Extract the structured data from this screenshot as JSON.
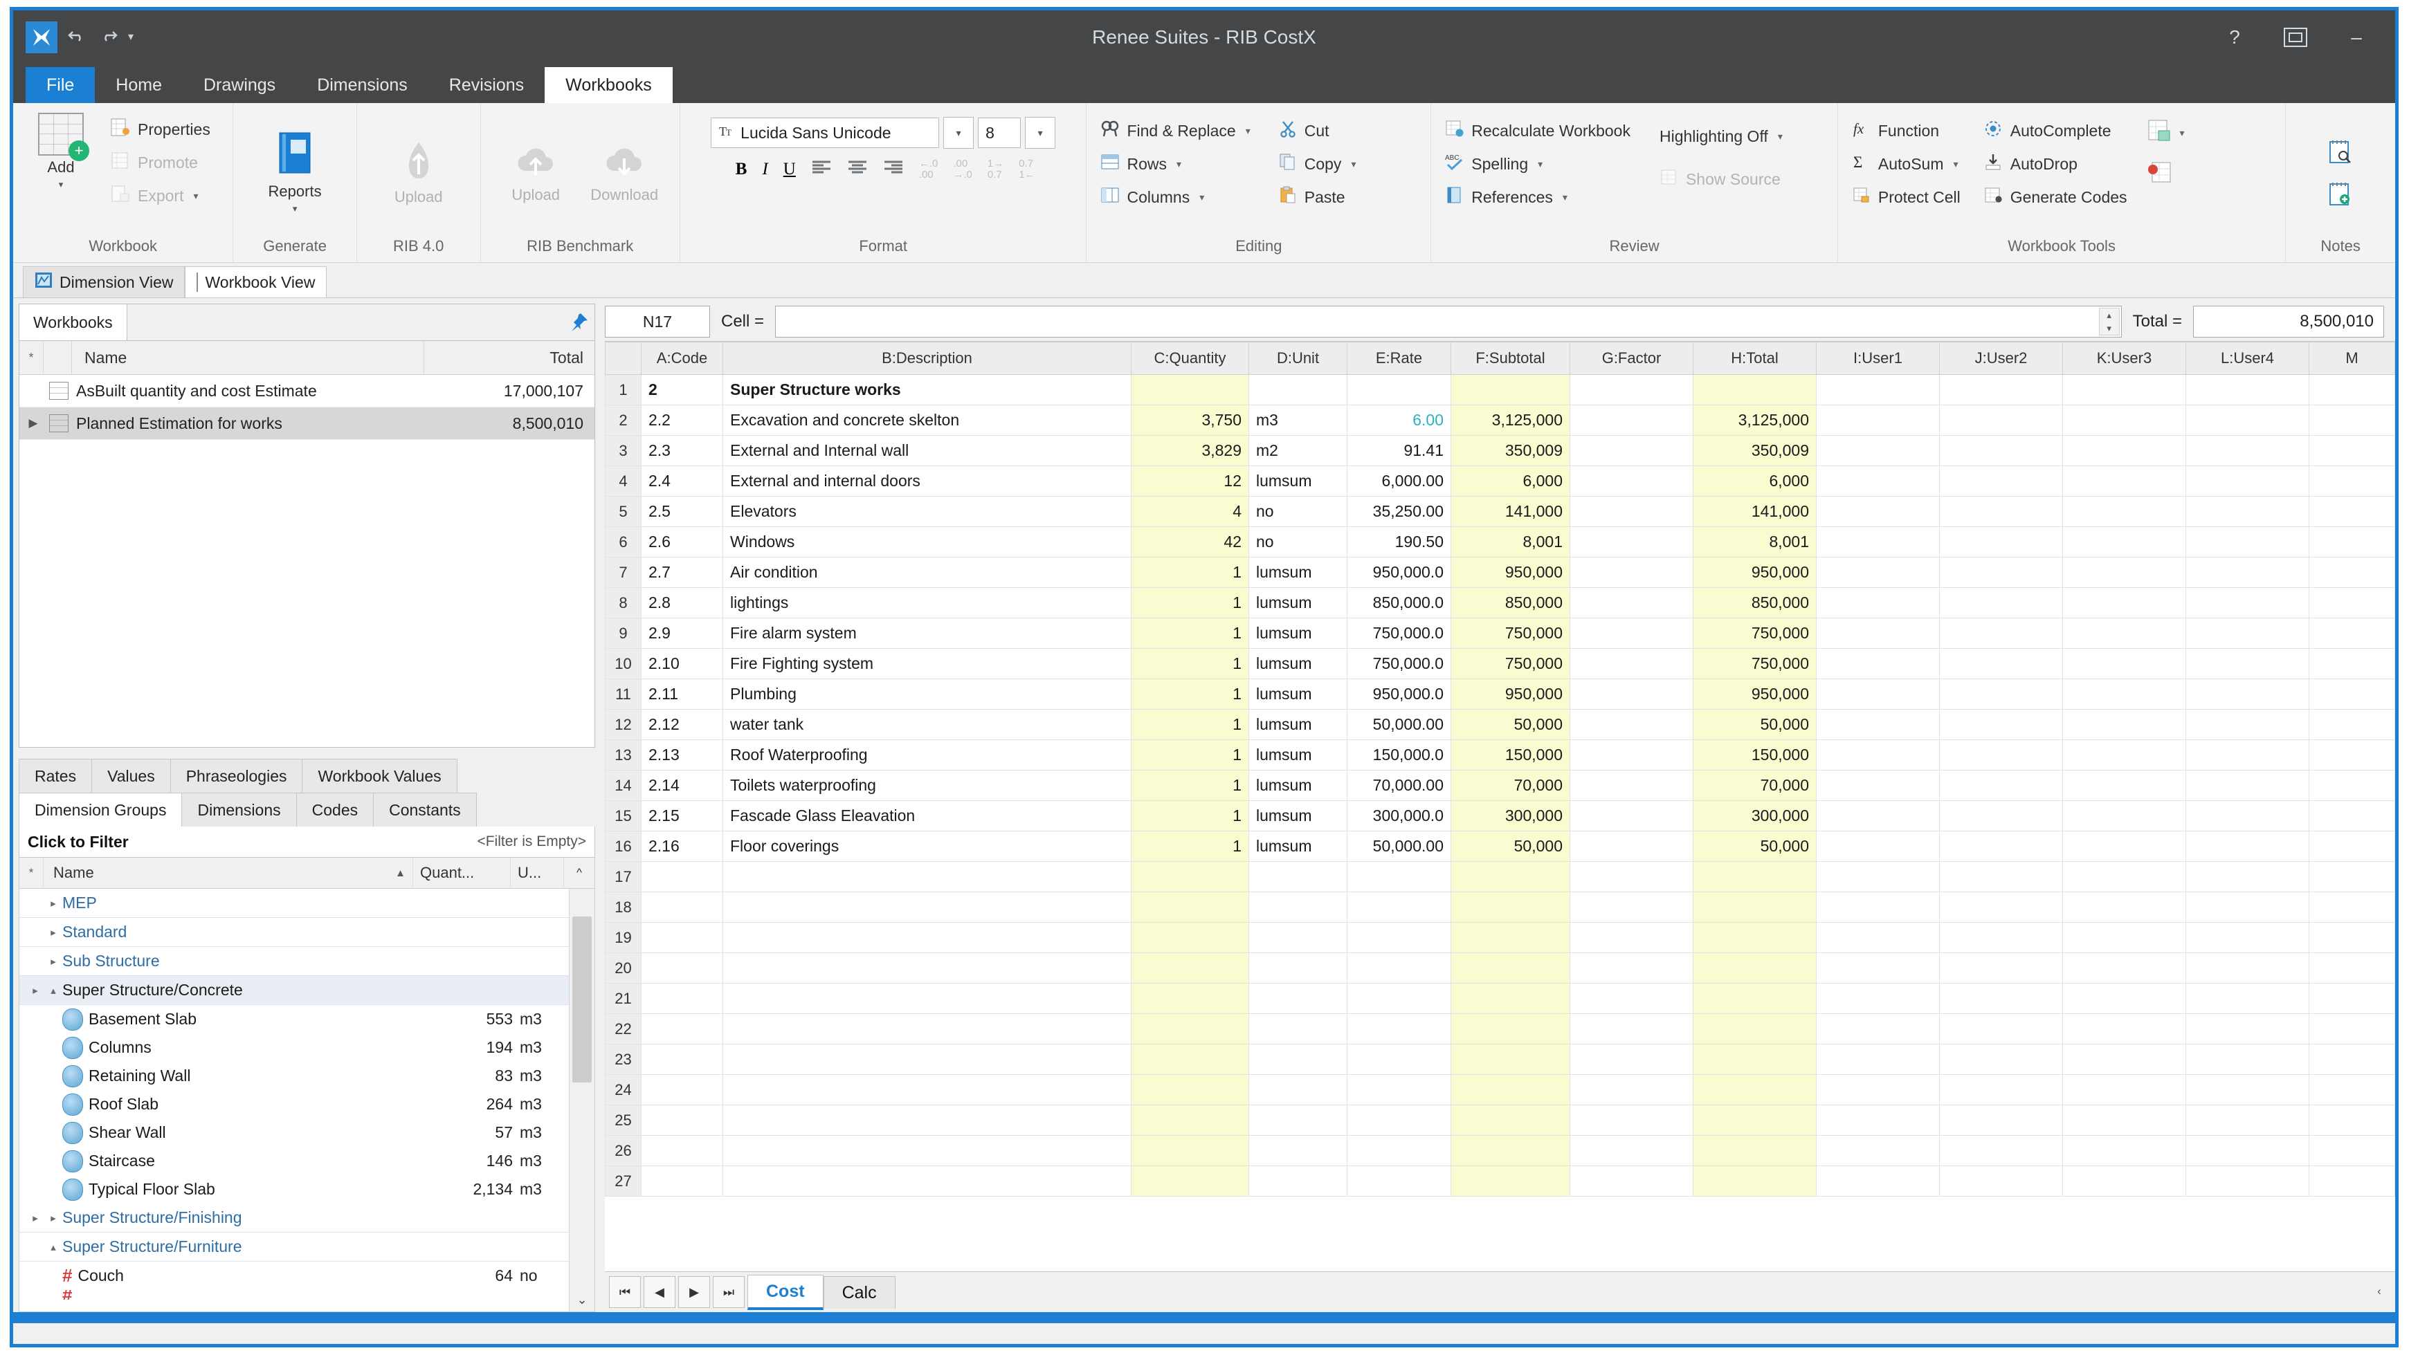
{
  "window": {
    "title": "Renee Suites - RIB CostX",
    "app_icon": "app-logo-icon",
    "quick_access": [
      "undo-icon",
      "redo-icon",
      "customize-quick-access-icon"
    ],
    "help_label": "?",
    "restore_label": "restore-icon",
    "minimize_label": "–"
  },
  "ribbon": {
    "tabs": [
      {
        "label": "File",
        "kind": "file"
      },
      {
        "label": "Home",
        "kind": "normal"
      },
      {
        "label": "Drawings",
        "kind": "normal"
      },
      {
        "label": "Dimensions",
        "kind": "normal"
      },
      {
        "label": "Revisions",
        "kind": "normal"
      },
      {
        "label": "Workbooks",
        "kind": "active"
      }
    ],
    "groups": {
      "workbook": {
        "label": "Workbook",
        "add_label": "Add",
        "items": [
          {
            "label": "Properties",
            "icon": "properties-icon",
            "disabled": false,
            "dropdown": false
          },
          {
            "label": "Promote",
            "icon": "promote-icon",
            "disabled": true,
            "dropdown": false
          },
          {
            "label": "Export",
            "icon": "export-icon",
            "disabled": true,
            "dropdown": true
          }
        ]
      },
      "generate": {
        "label": "Generate",
        "button": "Reports"
      },
      "rib40": {
        "label": "RIB 4.0",
        "button": "Upload"
      },
      "ribbenchmark": {
        "label": "RIB Benchmark",
        "buttons": [
          "Upload",
          "Download"
        ]
      },
      "format": {
        "label": "Format",
        "font_name": "Lucida Sans Unicode",
        "font_size": "8",
        "buttons": [
          "B",
          "I",
          "U",
          "align-left-icon",
          "align-center-icon",
          "align-right-icon",
          "increase-decimal-icon",
          "decrease-decimal-icon",
          "increase-indent-icon",
          "decrease-indent-icon"
        ]
      },
      "editing": {
        "label": "Editing",
        "items": [
          {
            "label": "Find & Replace",
            "icon": "find-replace-icon",
            "dropdown": true
          },
          {
            "label": "Cut",
            "icon": "cut-icon",
            "dropdown": false
          },
          {
            "label": "Rows",
            "icon": "rows-icon",
            "dropdown": true
          },
          {
            "label": "Copy",
            "icon": "copy-icon",
            "dropdown": true
          },
          {
            "label": "Columns",
            "icon": "columns-icon",
            "dropdown": true
          },
          {
            "label": "Paste",
            "icon": "paste-icon",
            "dropdown": false
          }
        ]
      },
      "review": {
        "label": "Review",
        "items": [
          {
            "label": "Recalculate Workbook",
            "icon": "recalculate-icon",
            "dropdown": false,
            "disabled": false
          },
          {
            "label": "Highlighting Off",
            "icon": "highlighting-icon",
            "dropdown": true,
            "disabled": false
          },
          {
            "label": "Spelling",
            "icon": "spelling-icon",
            "dropdown": true,
            "disabled": false
          },
          {
            "label": "Show Source",
            "icon": "show-source-icon",
            "dropdown": false,
            "disabled": true
          },
          {
            "label": "References",
            "icon": "references-icon",
            "dropdown": true,
            "disabled": false
          }
        ]
      },
      "workbook_tools": {
        "label": "Workbook Tools",
        "items": [
          {
            "label": "Function",
            "icon": "function-icon",
            "dropdown": false
          },
          {
            "label": "AutoComplete",
            "icon": "autocomplete-icon",
            "dropdown": false
          },
          {
            "label": "AutoSum",
            "icon": "autosum-icon",
            "dropdown": true
          },
          {
            "label": "AutoDrop",
            "icon": "autodrop-icon",
            "dropdown": false
          },
          {
            "label": "Protect Cell",
            "icon": "protect-cell-icon",
            "dropdown": false
          },
          {
            "label": "Generate Codes",
            "icon": "generate-codes-icon",
            "dropdown": false
          }
        ],
        "extra_icons": [
          "insert-sheet-icon",
          "replace-codes-icon"
        ]
      },
      "notes": {
        "label": "Notes",
        "icons": [
          "view-note-icon",
          "add-note-icon"
        ]
      }
    }
  },
  "view_tabs": [
    {
      "label": "Dimension View",
      "icon": "dimension-view-icon",
      "active": false
    },
    {
      "label": "Workbook View",
      "icon": "workbook-view-icon",
      "active": true
    }
  ],
  "workbooks_panel": {
    "tab_label": "Workbooks",
    "pin_icon": "pin-icon",
    "columns": [
      "Name",
      "Total"
    ],
    "star_col": "*",
    "rows": [
      {
        "name": "AsBuilt quantity and cost Estimate",
        "total": "17,000,107",
        "selected": false,
        "expandable": false
      },
      {
        "name": "Planned Estimation for works",
        "total": "8,500,010",
        "selected": true,
        "expandable": true
      }
    ]
  },
  "lower_left": {
    "tabs_top": [
      {
        "label": "Rates",
        "active": false
      },
      {
        "label": "Values",
        "active": false
      },
      {
        "label": "Phraseologies",
        "active": false
      },
      {
        "label": "Workbook Values",
        "active": false
      }
    ],
    "tabs_bottom": [
      {
        "label": "Dimension Groups",
        "active": true
      },
      {
        "label": "Dimensions",
        "active": false
      },
      {
        "label": "Codes",
        "active": false
      },
      {
        "label": "Constants",
        "active": false
      }
    ],
    "filter_label": "Click to Filter",
    "filter_empty": "<Filter is Empty>",
    "tree_columns": {
      "star": "*",
      "name": "Name",
      "quantity": "Quant...",
      "unit": "U...",
      "scroll": "^"
    },
    "tree": [
      {
        "type": "group",
        "label": "MEP",
        "collapsed": true,
        "outer": false
      },
      {
        "type": "group",
        "label": "Standard",
        "collapsed": true,
        "outer": false
      },
      {
        "type": "group",
        "label": "Sub Structure",
        "collapsed": true,
        "outer": false
      },
      {
        "type": "group",
        "label": "Super Structure/Concrete",
        "collapsed": false,
        "outer": true,
        "selected": true
      },
      {
        "type": "leaf",
        "icon": "dimension-group-icon",
        "label": "Basement Slab",
        "quantity": "553",
        "unit": "m3"
      },
      {
        "type": "leaf",
        "icon": "dimension-group-icon",
        "label": "Columns",
        "quantity": "194",
        "unit": "m3"
      },
      {
        "type": "leaf",
        "icon": "dimension-group-icon",
        "label": "Retaining Wall",
        "quantity": "83",
        "unit": "m3"
      },
      {
        "type": "leaf",
        "icon": "dimension-group-icon",
        "label": "Roof Slab",
        "quantity": "264",
        "unit": "m3"
      },
      {
        "type": "leaf",
        "icon": "dimension-group-icon",
        "label": "Shear Wall",
        "quantity": "57",
        "unit": "m3"
      },
      {
        "type": "leaf",
        "icon": "dimension-group-icon",
        "label": "Staircase",
        "quantity": "146",
        "unit": "m3"
      },
      {
        "type": "leaf",
        "icon": "dimension-group-icon",
        "label": "Typical Floor Slab",
        "quantity": "2,134",
        "unit": "m3"
      },
      {
        "type": "group",
        "label": "Super Structure/Finishing",
        "collapsed": true,
        "outer": true
      },
      {
        "type": "group",
        "label": "Super Structure/Furniture",
        "collapsed": false,
        "outer": false
      },
      {
        "type": "leaf",
        "icon": "count-dimension-icon",
        "label": "Couch",
        "quantity": "64",
        "unit": "no"
      }
    ]
  },
  "formula_bar": {
    "cell_ref": "N17",
    "cell_label": "Cell =",
    "cell_value": "",
    "cell_placeholder": "",
    "total_label": "Total =",
    "total_value": "8,500,010"
  },
  "sheet": {
    "columns": [
      "A:Code",
      "B:Description",
      "C:Quantity",
      "D:Unit",
      "E:Rate",
      "F:Subtotal",
      "G:Factor",
      "H:Total",
      "I:User1",
      "J:User2",
      "K:User3",
      "L:User4",
      "M"
    ],
    "rows": [
      {
        "n": "1",
        "code": "2",
        "desc": "Super Structure works",
        "qty": "",
        "unit": "",
        "rate": "",
        "subtotal": "",
        "factor": "",
        "total": "",
        "bold": true
      },
      {
        "n": "2",
        "code": "2.2",
        "desc": "Excavation and concrete skelton",
        "qty": "3,750",
        "unit": "m3",
        "rate": "6.00",
        "subtotal": "3,125,000",
        "factor": "",
        "total": "3,125,000",
        "rate_teal": true
      },
      {
        "n": "3",
        "code": "2.3",
        "desc": "External and Internal wall",
        "qty": "3,829",
        "unit": "m2",
        "rate": "91.41",
        "subtotal": "350,009",
        "factor": "",
        "total": "350,009"
      },
      {
        "n": "4",
        "code": "2.4",
        "desc": "External and internal doors",
        "qty": "12",
        "unit": "lumsum",
        "rate": "6,000.00",
        "subtotal": "6,000",
        "factor": "",
        "total": "6,000"
      },
      {
        "n": "5",
        "code": "2.5",
        "desc": "Elevators",
        "qty": "4",
        "unit": "no",
        "rate": "35,250.00",
        "subtotal": "141,000",
        "factor": "",
        "total": "141,000"
      },
      {
        "n": "6",
        "code": "2.6",
        "desc": "Windows",
        "qty": "42",
        "unit": "no",
        "rate": "190.50",
        "subtotal": "8,001",
        "factor": "",
        "total": "8,001"
      },
      {
        "n": "7",
        "code": "2.7",
        "desc": "Air condition",
        "qty": "1",
        "unit": "lumsum",
        "rate": "950,000.0",
        "subtotal": "950,000",
        "factor": "",
        "total": "950,000"
      },
      {
        "n": "8",
        "code": "2.8",
        "desc": "lightings",
        "qty": "1",
        "unit": "lumsum",
        "rate": "850,000.0",
        "subtotal": "850,000",
        "factor": "",
        "total": "850,000"
      },
      {
        "n": "9",
        "code": "2.9",
        "desc": "Fire alarm  system",
        "qty": "1",
        "unit": "lumsum",
        "rate": "750,000.0",
        "subtotal": "750,000",
        "factor": "",
        "total": "750,000"
      },
      {
        "n": "10",
        "code": "2.10",
        "desc": "Fire Fighting system",
        "qty": "1",
        "unit": "lumsum",
        "rate": "750,000.0",
        "subtotal": "750,000",
        "factor": "",
        "total": "750,000"
      },
      {
        "n": "11",
        "code": "2.11",
        "desc": "Plumbing",
        "qty": "1",
        "unit": "lumsum",
        "rate": "950,000.0",
        "subtotal": "950,000",
        "factor": "",
        "total": "950,000"
      },
      {
        "n": "12",
        "code": "2.12",
        "desc": "water tank",
        "qty": "1",
        "unit": "lumsum",
        "rate": "50,000.00",
        "subtotal": "50,000",
        "factor": "",
        "total": "50,000"
      },
      {
        "n": "13",
        "code": "2.13",
        "desc": "Roof Waterproofing",
        "qty": "1",
        "unit": "lumsum",
        "rate": "150,000.0",
        "subtotal": "150,000",
        "factor": "",
        "total": "150,000"
      },
      {
        "n": "14",
        "code": "2.14",
        "desc": "Toilets waterproofing",
        "qty": "1",
        "unit": "lumsum",
        "rate": "70,000.00",
        "subtotal": "70,000",
        "factor": "",
        "total": "70,000"
      },
      {
        "n": "15",
        "code": "2.15",
        "desc": "Fascade Glass Eleavation",
        "qty": "1",
        "unit": "lumsum",
        "rate": "300,000.0",
        "subtotal": "300,000",
        "factor": "",
        "total": "300,000"
      },
      {
        "n": "16",
        "code": "2.16",
        "desc": "Floor coverings",
        "qty": "1",
        "unit": "lumsum",
        "rate": "50,000.00",
        "subtotal": "50,000",
        "factor": "",
        "total": "50,000"
      },
      {
        "n": "17",
        "code": "",
        "desc": "",
        "qty": "",
        "unit": "",
        "rate": "",
        "subtotal": "",
        "factor": "",
        "total": "",
        "current": true
      },
      {
        "n": "18",
        "code": "",
        "desc": "",
        "qty": "",
        "unit": "",
        "rate": "",
        "subtotal": "",
        "factor": "",
        "total": ""
      },
      {
        "n": "19",
        "code": "",
        "desc": "",
        "qty": "",
        "unit": "",
        "rate": "",
        "subtotal": "",
        "factor": "",
        "total": ""
      },
      {
        "n": "20",
        "code": "",
        "desc": "",
        "qty": "",
        "unit": "",
        "rate": "",
        "subtotal": "",
        "factor": "",
        "total": ""
      },
      {
        "n": "21",
        "code": "",
        "desc": "",
        "qty": "",
        "unit": "",
        "rate": "",
        "subtotal": "",
        "factor": "",
        "total": ""
      },
      {
        "n": "22",
        "code": "",
        "desc": "",
        "qty": "",
        "unit": "",
        "rate": "",
        "subtotal": "",
        "factor": "",
        "total": ""
      },
      {
        "n": "23",
        "code": "",
        "desc": "",
        "qty": "",
        "unit": "",
        "rate": "",
        "subtotal": "",
        "factor": "",
        "total": ""
      },
      {
        "n": "24",
        "code": "",
        "desc": "",
        "qty": "",
        "unit": "",
        "rate": "",
        "subtotal": "",
        "factor": "",
        "total": ""
      },
      {
        "n": "25",
        "code": "",
        "desc": "",
        "qty": "",
        "unit": "",
        "rate": "",
        "subtotal": "",
        "factor": "",
        "total": ""
      },
      {
        "n": "26",
        "code": "",
        "desc": "",
        "qty": "",
        "unit": "",
        "rate": "",
        "subtotal": "",
        "factor": "",
        "total": ""
      },
      {
        "n": "27",
        "code": "",
        "desc": "",
        "qty": "",
        "unit": "",
        "rate": "",
        "subtotal": "",
        "factor": "",
        "total": ""
      }
    ]
  },
  "sheet_tabs": {
    "nav": [
      "first-sheet-icon",
      "prev-sheet-icon",
      "next-sheet-icon",
      "last-sheet-icon"
    ],
    "tabs": [
      {
        "label": "Cost",
        "active": true
      },
      {
        "label": "Calc",
        "active": false
      }
    ]
  },
  "colors": {
    "accent": "#1b7fd4",
    "titlebar": "#444648",
    "highlight_cell": "#fbfbd2",
    "teal_value": "#2bb3c0",
    "tree_group": "#2e6da4"
  }
}
